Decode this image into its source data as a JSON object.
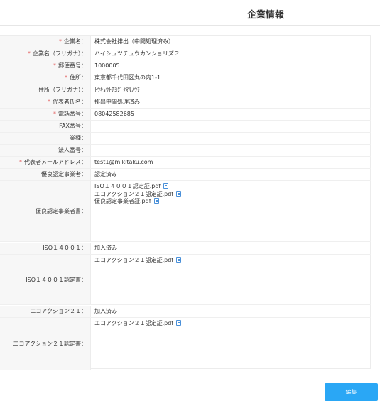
{
  "header": {
    "title": "企業情報"
  },
  "rows": [
    {
      "label": "企業名：",
      "required": true,
      "value": "株式会社排出（中間処理済み）"
    },
    {
      "label": "企業名（フリガナ）：",
      "required": true,
      "value": "ハイシュツチュウカンショリズミ"
    },
    {
      "label": "郵便番号：",
      "required": true,
      "value": "1000005"
    },
    {
      "label": "住所：",
      "required": true,
      "value": "東京都千代田区丸の内1-1"
    },
    {
      "label": "住所（フリガナ）：",
      "required": false,
      "value": "ﾄｳｷｮｳﾄﾁﾖﾀﾞｸﾏﾙﾉｳﾁ"
    },
    {
      "label": "代表者氏名：",
      "required": true,
      "value": "排出中間処理済み"
    },
    {
      "label": "電話番号：",
      "required": true,
      "value": "08042582685"
    },
    {
      "label": "FAX番号：",
      "required": false,
      "value": ""
    },
    {
      "label": "業種：",
      "required": false,
      "value": ""
    },
    {
      "label": "法人番号：",
      "required": false,
      "value": ""
    },
    {
      "label": "代表者メールアドレス：",
      "required": true,
      "value": "test1@mikitaku.com"
    },
    {
      "label": "優良認定事業者：",
      "required": false,
      "value": "認定済み"
    }
  ],
  "cert_docs": {
    "label": "優良認定事業者書：",
    "files": [
      "ISO１４００１認定証.pdf",
      "エコアクション２１認定証.pdf",
      "優良認定事業者証.pdf"
    ]
  },
  "iso": {
    "label": "ISO１４００１：",
    "value": "加入済み"
  },
  "iso_cert": {
    "label": "ISO１４００１認定書：",
    "files": [
      "エコアクション２１認定証.pdf"
    ]
  },
  "eco": {
    "label": "エコアクション２１：",
    "value": "加入済み"
  },
  "eco_cert": {
    "label": "エコアクション２１認定書：",
    "files": [
      "エコアクション２１認定証.pdf"
    ]
  },
  "actions": {
    "edit_label": "編集"
  },
  "colors": {
    "required_mark": "#e35a5a",
    "primary_button": "#2aa7f5",
    "file_icon": "#4a90d9"
  },
  "required_mark": "*"
}
